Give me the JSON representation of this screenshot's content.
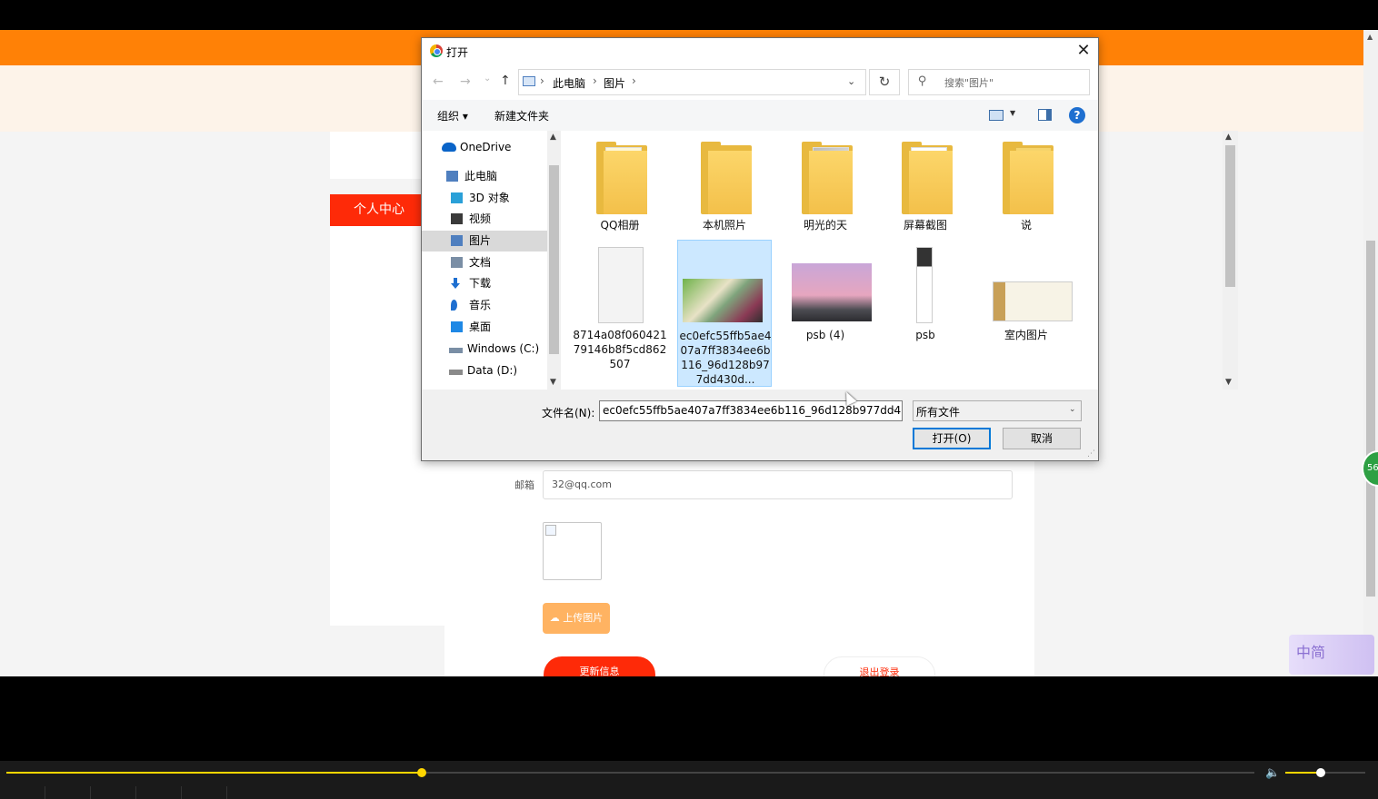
{
  "webpage": {
    "sidebar_title": "个人中心",
    "email_label": "邮箱",
    "email_value": "32@qq.com",
    "upload_button": "上传图片",
    "update_button": "更新信息",
    "logout_button": "退出登录",
    "side_badge_number": "56",
    "ime_badge_text": "中简"
  },
  "dialog": {
    "title": "打开",
    "close_glyph": "✕",
    "nav": {
      "back_glyph": "←",
      "forward_glyph": "→",
      "recent_glyph": "⌄",
      "up_glyph": "↑",
      "breadcrumb": [
        "此电脑",
        "图片"
      ],
      "crumb_sep": "›",
      "dropdown_glyph": "⌄",
      "refresh_glyph": "↻",
      "search_placeholder": "搜索\"图片\"",
      "search_glyph": "⚲"
    },
    "toolbar": {
      "organize": "组织 ▾",
      "new_folder": "新建文件夹",
      "view_dropdown": "▼",
      "help": "?"
    },
    "nav_pane": [
      {
        "label": "OneDrive",
        "icon": "cloud-icon",
        "color": "#0a64c8",
        "selected": false
      },
      {
        "label": "此电脑",
        "icon": "computer-icon",
        "color": "#4f7fbf",
        "selected": false
      },
      {
        "label": "3D 对象",
        "icon": "cube-icon",
        "color": "#2aa0d8",
        "selected": false
      },
      {
        "label": "视频",
        "icon": "video-icon",
        "color": "#3a3a3a",
        "selected": false
      },
      {
        "label": "图片",
        "icon": "picture-icon",
        "color": "#4f7fbf",
        "selected": true
      },
      {
        "label": "文档",
        "icon": "document-icon",
        "color": "#7a8ea5",
        "selected": false
      },
      {
        "label": "下载",
        "icon": "download-icon",
        "color": "#1e6fd0",
        "selected": false
      },
      {
        "label": "音乐",
        "icon": "music-icon",
        "color": "#1e6fd0",
        "selected": false
      },
      {
        "label": "桌面",
        "icon": "desktop-icon",
        "color": "#1e88e5",
        "selected": false
      },
      {
        "label": "Windows (C:)",
        "icon": "windows-drive-icon",
        "color": "#7a8ea5",
        "selected": false
      },
      {
        "label": "Data (D:)",
        "icon": "drive-icon",
        "color": "#8a8a8a",
        "selected": false
      }
    ],
    "scroll_up_glyph": "▲",
    "scroll_down_glyph": "▼",
    "files": [
      {
        "label": "QQ相册",
        "kind": "folder",
        "selected": false
      },
      {
        "label": "本机照片",
        "kind": "folder",
        "selected": false
      },
      {
        "label": "明光的天",
        "kind": "folder",
        "selected": false
      },
      {
        "label": "屏幕截图",
        "kind": "folder",
        "selected": false
      },
      {
        "label": "说",
        "kind": "folder",
        "selected": false
      },
      {
        "label": "8714a08f06042179146b8f5cd862507",
        "kind": "document-image",
        "selected": false
      },
      {
        "label": "ec0efc55ffb5ae407a7ff3834ee6b116_96d128b977dd430d...",
        "kind": "anime-image",
        "selected": true
      },
      {
        "label": "psb (4)",
        "kind": "sky-image",
        "selected": false
      },
      {
        "label": "psb",
        "kind": "tall-image",
        "selected": false
      },
      {
        "label": "室内图片",
        "kind": "map-image",
        "selected": false
      }
    ],
    "bottom": {
      "filename_label": "文件名(N):",
      "filename_value": "ec0efc55ffb5ae407a7ff3834ee6b116_96d128b977dd4",
      "filetype_value": "所有文件",
      "dropdown_glyph": "⌄",
      "open_button": "打开(O)",
      "cancel_button": "取消",
      "grip_glyph": "⋰"
    }
  },
  "player": {
    "progress_fraction": 0.33,
    "volume_fraction": 0.4,
    "volume_glyph": "🔈",
    "accent_color": "#ffd600"
  }
}
